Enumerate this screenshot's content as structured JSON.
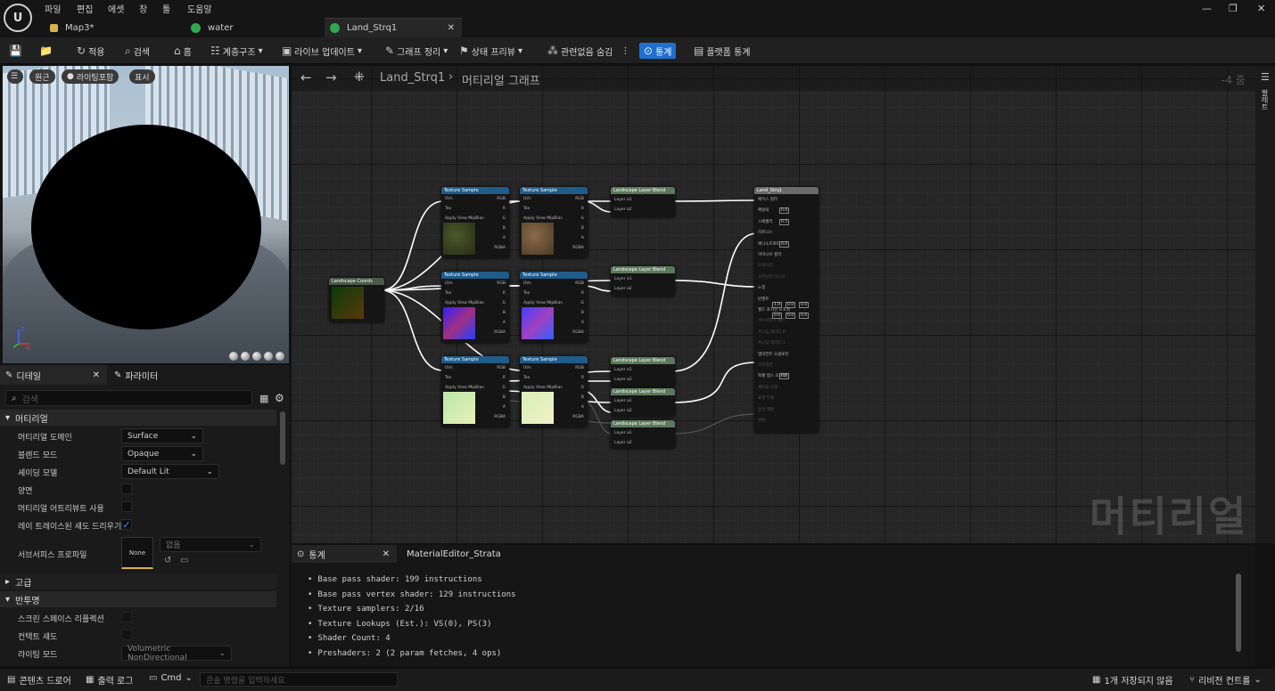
{
  "menu": [
    "파일",
    "편집",
    "에셋",
    "창",
    "툴",
    "도움말"
  ],
  "tabs": [
    {
      "label": "Map3*"
    },
    {
      "label": "water"
    },
    {
      "label": "Land_Strq1"
    }
  ],
  "window_controls": [
    "—",
    "❐",
    "✕"
  ],
  "toolbar": {
    "apply": "적용",
    "search": "검색",
    "home": "홈",
    "hierarchy": "계층구조",
    "live_update": "라이브 업데이트",
    "graph_clean": "그래프 정리",
    "state_preview": "상태 프리뷰",
    "hide_unrelated": "관련없음 숨김",
    "stats": "통계",
    "platform_stats": "플랫폼 통계"
  },
  "viewport": {
    "chips": [
      "원근",
      "라이팅포함",
      "표시"
    ],
    "axis_labels": [
      "Z",
      "X"
    ]
  },
  "graph": {
    "asset": "Land_Strq1",
    "section": "머티리얼 그래프",
    "zoom": "-4 줌",
    "watermark": "머티리얼",
    "palette": "팔레트"
  },
  "details": {
    "tab_details": "디테일",
    "tab_params": "파라미터",
    "search_placeholder": "검색",
    "sec_material": "머티리얼",
    "rows": [
      {
        "label": "머티리얼 도메인",
        "value": "Surface"
      },
      {
        "label": "블렌드 모드",
        "value": "Opaque"
      },
      {
        "label": "셰이딩 모델",
        "value": "Default Lit"
      },
      {
        "label": "양면"
      },
      {
        "label": "머티리얼 어트리뷰트 사용"
      },
      {
        "label": "레이 트레이스된 섀도 드리우기"
      }
    ],
    "subsurface": {
      "label": "서브서피스 프로파일",
      "thumb": "None",
      "dropdown": "없음"
    },
    "sec_advanced": "고급",
    "sec_translucency": "반투명",
    "rows2": [
      {
        "label": "스크린 스페이스 리플렉션"
      },
      {
        "label": "컨택트 섀도"
      },
      {
        "label": "라이팅 모드",
        "value": "Volumetric NonDirectional"
      }
    ]
  },
  "nodes": {
    "coords": "Landscape Coords",
    "tex": "Texture Sample",
    "blend": "Landscape Layer Blend",
    "result": "Land_Strq1",
    "tex_pins_in": [
      "UVs",
      "Tex",
      "Apply View MipBias"
    ],
    "tex_pins_out": [
      "RGB",
      "R",
      "G",
      "B",
      "A",
      "RGBA"
    ],
    "blend_pins": [
      "Layer a1",
      "Layer a2"
    ],
    "result_pins": [
      "베이스 컬러",
      "메탈릭",
      "스페큘러",
      "러프니스",
      "애니소트로피",
      "이미시브 컬러",
      "오파시티",
      "오파시티 마스크",
      "노멀",
      "탄젠트",
      "월드 포지션 오프셋",
      "서브서피스 컬러",
      "커스텀 데이터 0",
      "커스텀 데이터 1",
      "앰비언트 오클루전",
      "리프랙션",
      "픽셀 뎁스 오프셋",
      "셰이딩 모델",
      "표면 두께",
      "앞면 재질",
      "변위"
    ],
    "values": {
      "metallic": "0.0",
      "specular": "0.5",
      "anis": "0.0",
      "tangent": [
        "1.0",
        "0.0",
        "0.0"
      ],
      "wpo": [
        "0.0",
        "0.0",
        "0.0"
      ],
      "pdo": "0.0"
    }
  },
  "stats": {
    "tab": "통계",
    "tab2": "MaterialEditor_Strata",
    "lines": [
      "Base pass shader: 199 instructions",
      "Base pass vertex shader: 129 instructions",
      "Texture samplers: 2/16",
      "Texture Lookups (Est.): VS(0), PS(3)",
      "Shader Count: 4",
      "Preshaders: 2  (2 param fetches, 4 ops)"
    ]
  },
  "statusbar": {
    "content": "콘텐츠 드로어",
    "output": "출력 로그",
    "cmd": "Cmd",
    "cmd_placeholder": "콘솔 명령을 입력하세요.",
    "unsaved": "1개 저장되지 않음",
    "revision": "리비전 컨트롤"
  },
  "colors": {
    "accent": "#1f6fd0",
    "node_tex": "#1f5c8a",
    "node_blend": "#5a7a5a",
    "node_result": "#6a6a6a"
  }
}
